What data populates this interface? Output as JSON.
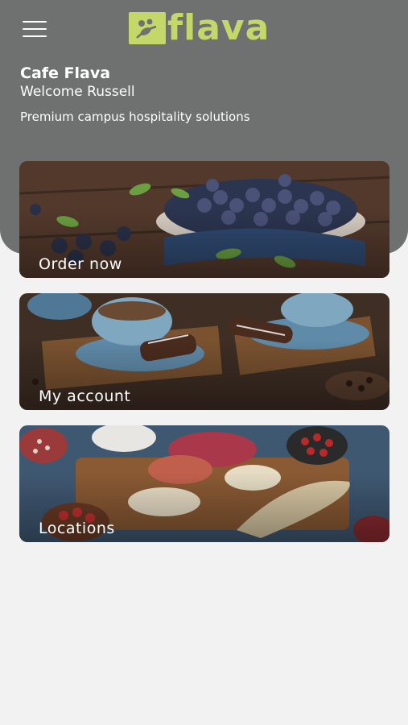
{
  "header": {
    "logo_text": "flava",
    "title": "Cafe Flava",
    "welcome": "Welcome Russell",
    "tagline": "Premium campus hospitality solutions"
  },
  "cards": [
    {
      "label": "Order now"
    },
    {
      "label": "My account"
    },
    {
      "label": "Locations"
    }
  ],
  "colors": {
    "header_bg": "#6f7070",
    "brand": "#c4d86a",
    "page_bg": "#f2f2f2"
  }
}
